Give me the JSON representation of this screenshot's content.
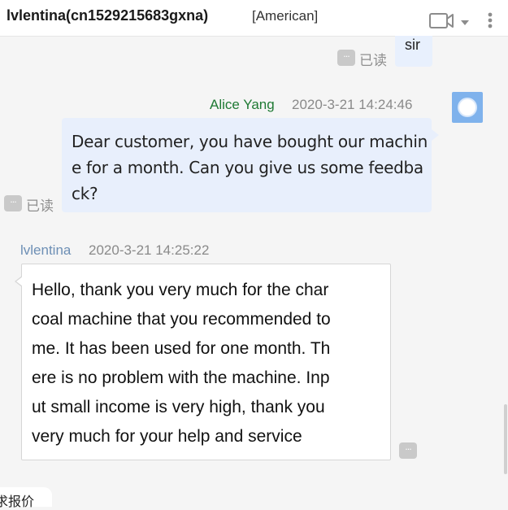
{
  "header": {
    "contact_name": "lvlentina(cn1529215683gxna)",
    "contact_tag": "[American]",
    "icons": [
      "video-camera-icon",
      "chevron-down-icon",
      "more-vertical-icon"
    ]
  },
  "previous_message": {
    "text": "sir",
    "read_status": "已读"
  },
  "messages": [
    {
      "sender": "Alice Yang",
      "timestamp": "2020-3-21 14:24:46",
      "direction": "outgoing",
      "lines": [
        "Dear customer, you have bought our machin",
        "e for a month. Can you give us some feedba",
        "ck?"
      ],
      "read_status": "已读"
    },
    {
      "sender": "lvlentina",
      "timestamp": "2020-3-21 14:25:22",
      "direction": "incoming",
      "lines": [
        "Hello, thank you very much for the char",
        "coal machine that you recommended to",
        "me. It has been used for one month. Th",
        "ere is no problem with the machine. Inp",
        "ut small income is very high, thank you",
        "very much for your help and service"
      ]
    }
  ],
  "footer": {
    "quote_tab_label": "求报价"
  },
  "colors": {
    "agent_name": "#1f7a34",
    "customer_name": "#6d8fb5",
    "agent_bubble": "#e8effc",
    "avatar": "#7fb2ec"
  }
}
